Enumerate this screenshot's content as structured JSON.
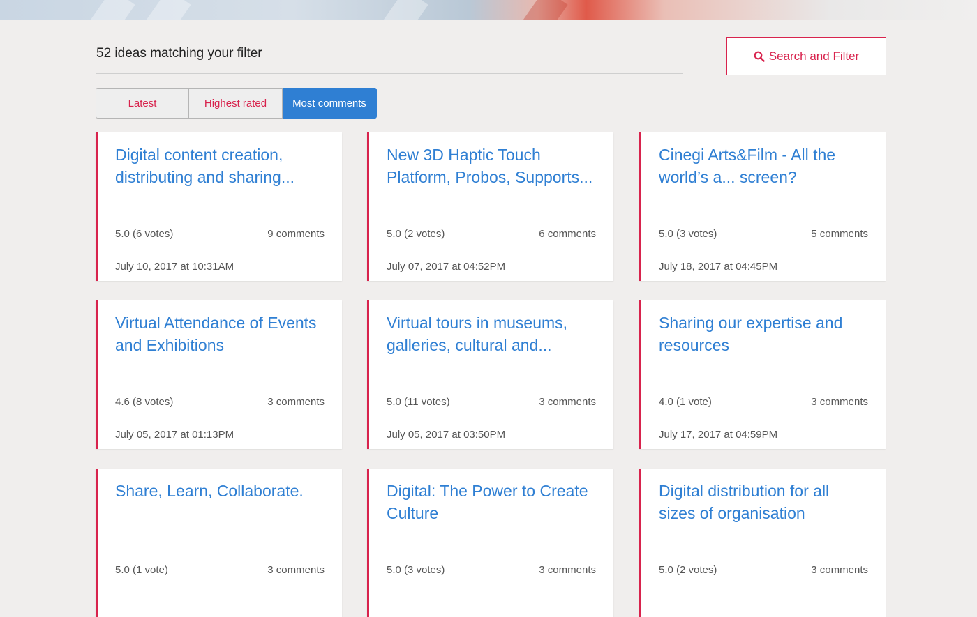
{
  "results": {
    "count_text": "52 ideas matching your filter",
    "search_button_label": "Search and Filter"
  },
  "sort_tabs": [
    {
      "label": "Latest",
      "active": false
    },
    {
      "label": "Highest rated",
      "active": false
    },
    {
      "label": "Most comments",
      "active": true
    }
  ],
  "ideas": [
    {
      "title": "Digital content creation, distributing and sharing...",
      "rating": "5.0 (6 votes)",
      "comments": "9 comments",
      "date": "July 10, 2017 at 10:31AM"
    },
    {
      "title": "New 3D Haptic Touch Platform, Probos, Supports...",
      "rating": "5.0 (2 votes)",
      "comments": "6 comments",
      "date": "July 07, 2017 at 04:52PM"
    },
    {
      "title": "Cinegi Arts&Film - All the world’s a... screen?",
      "rating": "5.0 (3 votes)",
      "comments": "5 comments",
      "date": "July 18, 2017 at 04:45PM"
    },
    {
      "title": "Virtual Attendance of Events and Exhibitions",
      "rating": "4.6 (8 votes)",
      "comments": "3 comments",
      "date": "July 05, 2017 at 01:13PM"
    },
    {
      "title": "Virtual tours in museums, galleries, cultural and...",
      "rating": "5.0 (11 votes)",
      "comments": "3 comments",
      "date": "July 05, 2017 at 03:50PM"
    },
    {
      "title": "Sharing our expertise and resources",
      "rating": "4.0 (1 vote)",
      "comments": "3 comments",
      "date": "July 17, 2017 at 04:59PM"
    },
    {
      "title": "Share, Learn, Collaborate.",
      "rating": "5.0 (1 vote)",
      "comments": "3 comments",
      "date": ""
    },
    {
      "title": "Digital: The Power to Create Culture",
      "rating": "5.0 (3 votes)",
      "comments": "3 comments",
      "date": ""
    },
    {
      "title": "Digital distribution for all sizes of organisation",
      "rating": "5.0 (2 votes)",
      "comments": "3 comments",
      "date": ""
    }
  ],
  "colors": {
    "accent_red": "#d8234d",
    "link_blue": "#2f7fd3",
    "background": "#f0eeed"
  },
  "icons": {
    "search_button_icon": "search-icon"
  }
}
